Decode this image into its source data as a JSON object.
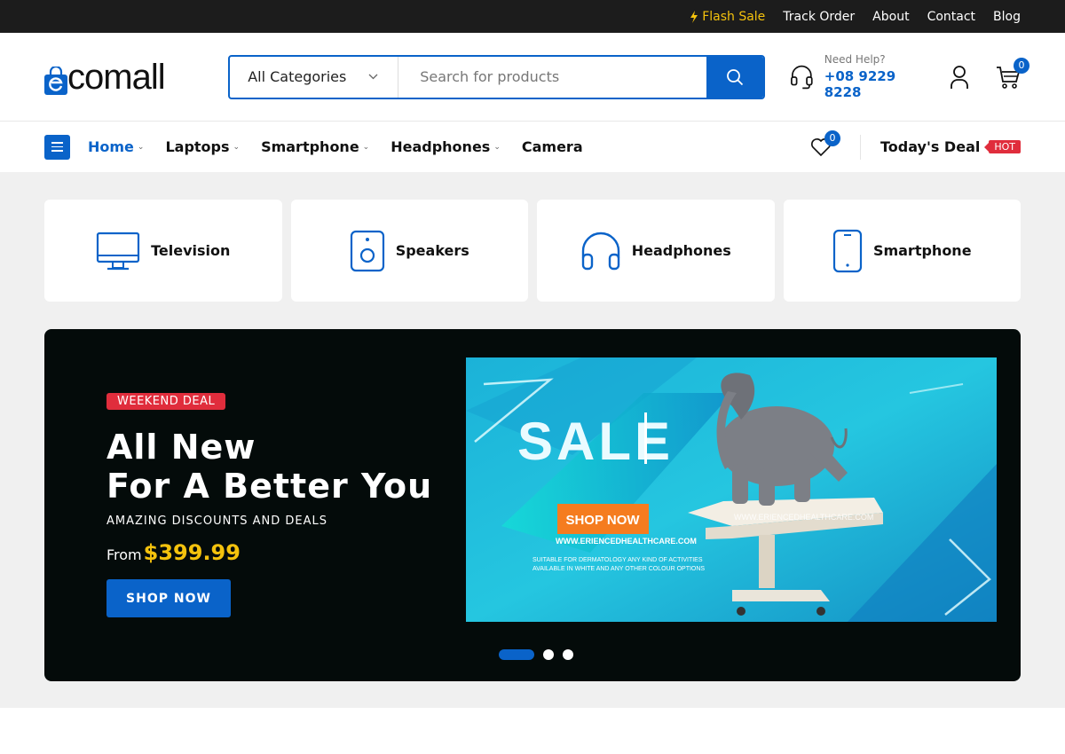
{
  "topbar": {
    "flash_sale": "Flash Sale",
    "track_order": "Track Order",
    "about": "About",
    "contact": "Contact",
    "blog": "Blog"
  },
  "header": {
    "logo_text": "comall",
    "category_select": "All Categories",
    "search_placeholder": "Search for products",
    "help_label": "Need Help?",
    "help_phone": "+08 9229 8228",
    "cart_count": "0"
  },
  "nav": {
    "items": [
      {
        "label": "Home"
      },
      {
        "label": "Laptops"
      },
      {
        "label": "Smartphone"
      },
      {
        "label": "Headphones"
      },
      {
        "label": "Camera"
      }
    ],
    "wishlist_count": "0",
    "todays_deal": "Today's Deal",
    "hot_badge": "HOT"
  },
  "categories": [
    {
      "label": "Television",
      "icon": "television-icon"
    },
    {
      "label": "Speakers",
      "icon": "speaker-icon"
    },
    {
      "label": "Headphones",
      "icon": "headphones-icon"
    },
    {
      "label": "Smartphone",
      "icon": "smartphone-icon"
    }
  ],
  "hero": {
    "tag": "WEEKEND DEAL",
    "headline_line1": "All New",
    "headline_line2": "For A Better You",
    "subtitle": "AMAZING DISCOUNTS AND DEALS",
    "from_label": "From",
    "price": "$399.99",
    "button": "SHOP NOW",
    "banner": {
      "sale_text": "SALE",
      "shop_now": "SHOP NOW",
      "url": "WWW.ERIENCEDHEALTHCARE.COM",
      "line1": "SUITABLE FOR DERMATOLOGY ANY KIND OF ACTIVITIES",
      "line2": "AVAILABLE IN WHITE AND ANY OTHER COLOUR OPTIONS"
    }
  },
  "colors": {
    "primary": "#0a63c9",
    "hot": "#e02d3c",
    "price": "#f4c20d"
  }
}
